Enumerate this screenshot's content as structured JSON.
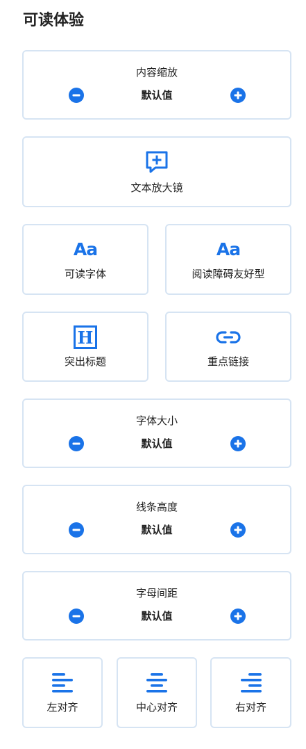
{
  "page": {
    "title": "可读体验"
  },
  "content_scale": {
    "label": "内容缩放",
    "value": "默认值",
    "minus_icon": "minus-circle-icon",
    "plus_icon": "plus-circle-icon"
  },
  "text_magnifier": {
    "label": "文本放大镜",
    "icon": "chat-plus-icon"
  },
  "readable_font": {
    "label": "可读字体",
    "glyph": "Aa"
  },
  "dyslexia_friendly": {
    "label": "阅读障碍友好型",
    "glyph": "Aa"
  },
  "highlight_titles": {
    "label": "突出标题",
    "glyph": "H"
  },
  "highlight_links": {
    "label": "重点链接",
    "icon": "link-icon"
  },
  "font_size": {
    "label": "字体大小",
    "value": "默认值"
  },
  "line_height": {
    "label": "线条高度",
    "value": "默认值"
  },
  "letter_spacing": {
    "label": "字母间距",
    "value": "默认值"
  },
  "align": {
    "left": {
      "label": "左对齐"
    },
    "center": {
      "label": "中心对齐"
    },
    "right": {
      "label": "右对齐"
    }
  },
  "colors": {
    "accent": "#1a73e8",
    "border": "#d6e4f3",
    "text": "#222222"
  }
}
